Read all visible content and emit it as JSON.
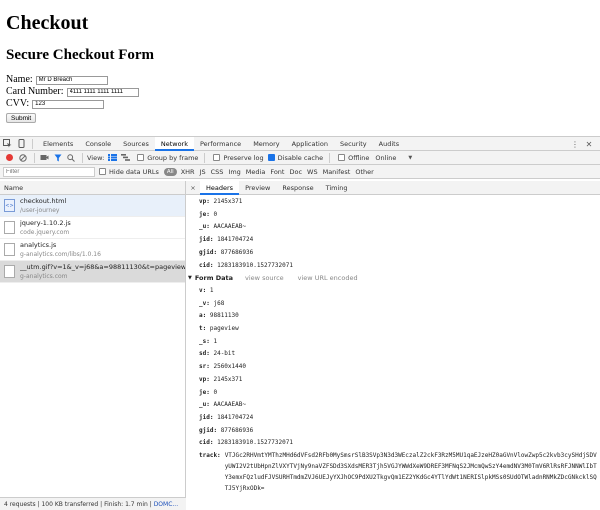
{
  "page": {
    "title": "Checkout",
    "subtitle": "Secure Checkout Form",
    "fields": [
      {
        "label": "Name:",
        "value": "Mr D Breach",
        "width": 72
      },
      {
        "label": "Card Number:",
        "value": "4111 1111 1111 1111",
        "width": 72
      },
      {
        "label": "CVV:",
        "value": "123",
        "width": 72
      }
    ],
    "submit_label": "Submit"
  },
  "devtools": {
    "tabs": [
      "Elements",
      "Console",
      "Sources",
      "Network",
      "Performance",
      "Memory",
      "Application",
      "Security",
      "Audits"
    ],
    "active_tab": "Network",
    "toolbar": {
      "view_label": "View:",
      "group_by_frame": "Group by frame",
      "preserve_log": "Preserve log",
      "disable_cache": "Disable cache",
      "offline": "Offline",
      "throttle": "Online"
    },
    "filter": {
      "placeholder": "Filter",
      "hide_data_urls": "Hide data URLs",
      "all": "All",
      "types": [
        "XHR",
        "JS",
        "CSS",
        "Img",
        "Media",
        "Font",
        "Doc",
        "WS",
        "Manifest",
        "Other"
      ]
    },
    "list_header": "Name",
    "requests": [
      {
        "name": "checkout.html",
        "sub": "/user-journey",
        "icon": "html-file-icon"
      },
      {
        "name": "jquery-1.10.2.js",
        "sub": "code.jquery.com",
        "icon": "js-file-icon"
      },
      {
        "name": "analytics.js",
        "sub": "g-analytics.com/libs/1.0.16",
        "icon": "js-file-icon"
      },
      {
        "name": "__utm.gif?v=1&_v=j68&a=98811130&t=pageview...",
        "sub": "g-analytics.com",
        "icon": "image-file-icon"
      }
    ],
    "status_bar": {
      "text": "4 requests | 100 KB transferred | Finish: 1.7 min | ",
      "dom": "DOMC..."
    },
    "detail_tabs": [
      "Headers",
      "Preview",
      "Response",
      "Timing"
    ],
    "active_detail_tab": "Headers",
    "top_params": [
      {
        "k": "vp:",
        "v": "2145x371"
      },
      {
        "k": "je:",
        "v": "0"
      },
      {
        "k": "_u:",
        "v": "AACAAEAB~"
      },
      {
        "k": "jid:",
        "v": "1841704724"
      },
      {
        "k": "gjid:",
        "v": "877686936"
      },
      {
        "k": "cid:",
        "v": "1283183910.1527732071"
      }
    ],
    "form_data": {
      "title": "Form Data",
      "view_source": "view source",
      "view_url_encoded": "view URL encoded",
      "params": [
        {
          "k": "v:",
          "v": "1"
        },
        {
          "k": "_v:",
          "v": "j68"
        },
        {
          "k": "a:",
          "v": "98811130"
        },
        {
          "k": "t:",
          "v": "pageview"
        },
        {
          "k": "_s:",
          "v": "1"
        },
        {
          "k": "sd:",
          "v": "24-bit"
        },
        {
          "k": "sr:",
          "v": "2560x1440"
        },
        {
          "k": "vp:",
          "v": "2145x371"
        },
        {
          "k": "je:",
          "v": "0"
        },
        {
          "k": "_u:",
          "v": "AACAAEAB~"
        },
        {
          "k": "jid:",
          "v": "1841704724"
        },
        {
          "k": "gjid:",
          "v": "877686936"
        },
        {
          "k": "cid:",
          "v": "1283183910.1527732071"
        }
      ],
      "track_key": "track:",
      "track_value": "VTJGc2RHVmtYMThzMHd6dVFsd2RFb0MySmsrSlB3SVp3N3d3WEczalZ2ckF3RzM5MU1qaEJzeHZ0aGVnVlowZwp5c2kvb3cySHdjSDVyUWI2V2tUbHpnZlVXYTVjNy9naVZFSDd3SXdsMER3Tjh5VGJYWWdXeW9DREF3MFNqS2JMcmQwSzY4emdNV3M0TmV6RlRsRFJNNWlIbTY3emxFQzludFJVSURHTmdmZVJ6UEJyYXJhOC9PdXU2TkgvQm1EZ2YKdGc4YTlYdWt1NERISlpkMSs0SUdOTWladnRNMkZDcGNkcklSQTJ5YjRxODk="
    }
  }
}
